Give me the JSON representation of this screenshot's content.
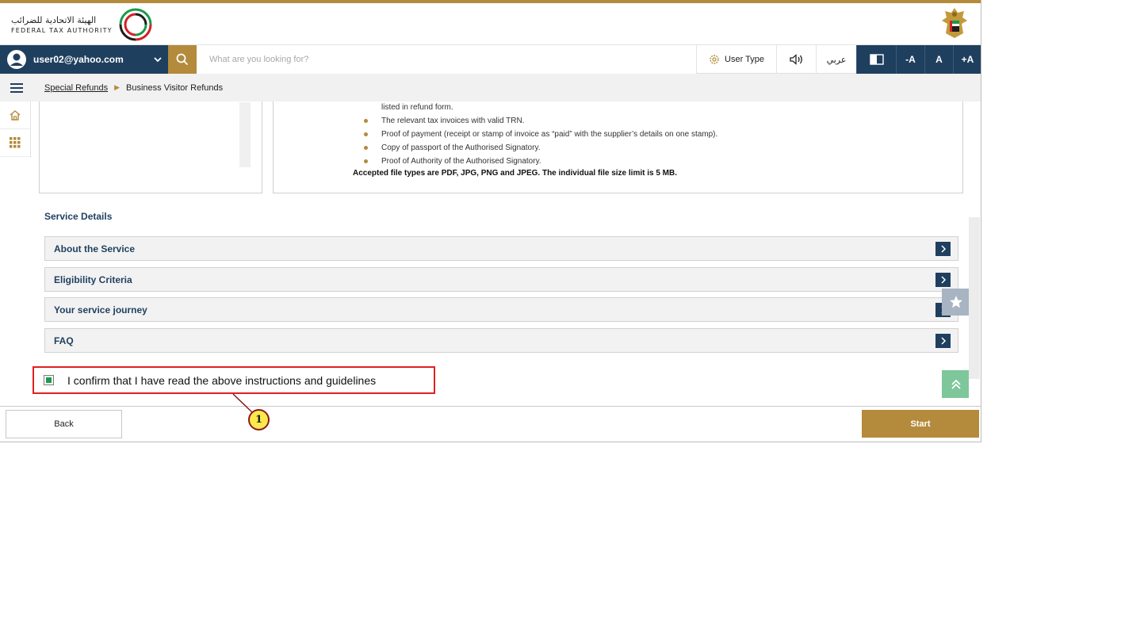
{
  "header": {
    "logo_arabic": "الهيئة الاتحادية للضرائب",
    "logo_english": "FEDERAL TAX AUTHORITY"
  },
  "toolbar": {
    "user_email": "user02@yahoo.com",
    "search_placeholder": "What are you looking for?",
    "user_type_label": "User Type",
    "arabic_label": "عربي",
    "font_decrease": "-A",
    "font_reset": "A",
    "font_increase": "+A"
  },
  "breadcrumb": {
    "parent": "Special Refunds",
    "current": "Business Visitor Refunds"
  },
  "requirements": {
    "items": [
      {
        "text": "listed in refund form.",
        "bullet": false
      },
      {
        "text": "The relevant tax invoices with valid TRN.",
        "bullet": true
      },
      {
        "text": "Proof of payment (receipt or stamp of invoice as “paid” with the supplier’s details on one stamp).",
        "bullet": true
      },
      {
        "text": "Copy of passport of the Authorised Signatory.",
        "bullet": true
      },
      {
        "text": "Proof of Authority of the Authorised Signatory.",
        "bullet": true
      }
    ],
    "file_note": "Accepted file types are PDF, JPG, PNG and JPEG. The individual file size limit is 5 MB."
  },
  "service_details": {
    "title": "Service Details",
    "sections": [
      "About the Service",
      "Eligibility Criteria",
      "Your service journey",
      "FAQ"
    ]
  },
  "confirm": {
    "label": "I confirm that I have read the above instructions and guidelines",
    "checked": true
  },
  "footer": {
    "back_label": "Back",
    "start_label": "Start"
  },
  "annotation": {
    "number": "1"
  },
  "colors": {
    "navy": "#1f3f5f",
    "gold": "#b48a3c",
    "highlight_red": "#e02020",
    "check_green": "#1a9a4a"
  }
}
